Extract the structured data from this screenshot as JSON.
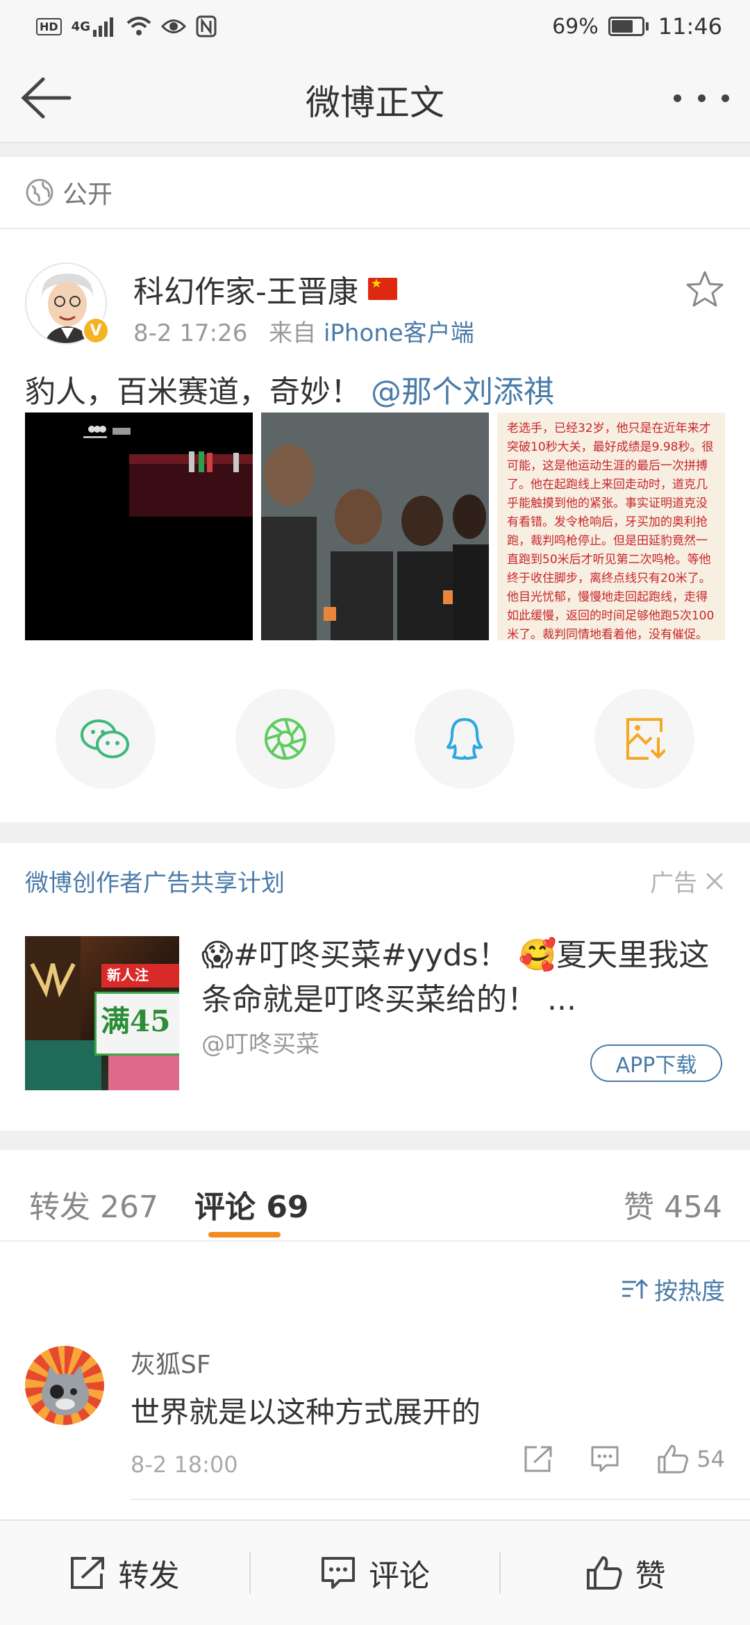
{
  "status_bar": {
    "left_badges": [
      "HD",
      "4G"
    ],
    "battery": "69%",
    "battery_level": 0.69,
    "time": "11:46"
  },
  "nav": {
    "title": "微博正文",
    "back_icon": "arrow-left-icon",
    "more_icon": "more-dots-icon"
  },
  "visibility": {
    "icon": "globe-icon",
    "label": "公开"
  },
  "post": {
    "author": "科幻作家-王晋康",
    "time": "8-2 17:26",
    "source_prefix": "来自",
    "source": "iPhone客户端",
    "text": "豹人，百米赛道，奇妙！",
    "mention": "@那个刘添祺",
    "image3_text": "老选手，已经32岁，他只是在近年来才突破10秒大关，最好成绩是9.98秒。很可能，这是他运动生涯的最后一次拼搏了。他在起跑线上来回走动时，道克几乎能触摸到他的紧张。事实证明道克没有看错。发令枪响后，牙买加的奥利抢跑，裁判鸣枪停止。但是田延豹竟然一直跑到50米后才听见第二次鸣枪。等他终于收住脚步，离终点线只有20米了。他目光忧郁，慢慢地走回起跑线，走得如此缓慢，返回的时间足够他跑5次100米了。裁判同情地看着他，没有催促。",
    "share_icons": [
      "wechat-icon",
      "moments-icon",
      "qq-icon",
      "save-image-icon"
    ]
  },
  "ad": {
    "header": "微博创作者广告共享计划",
    "tag": "广告",
    "thumb_badge": "新人注",
    "thumb_banner": "满45",
    "text": "😱#叮咚买菜#yyds！ 🥰夏天里我这条命就是叮咚买菜给的！ ...",
    "handle": "@叮咚买菜",
    "button": "APP下载"
  },
  "tabs": {
    "repost": "转发 267",
    "comments": "评论 69",
    "likes": "赞 454"
  },
  "sort_label": "按热度",
  "comment": {
    "name": "灰狐SF",
    "text": "世界就是以这种方式展开的",
    "time": "8-2 18:00",
    "like_count": "54"
  },
  "bottom_bar": {
    "repost": "转发",
    "comment": "评论",
    "like": "赞"
  },
  "colors": {
    "link": "#4a7ba8",
    "accent": "#f28c1d",
    "verified": "#f3b323"
  }
}
